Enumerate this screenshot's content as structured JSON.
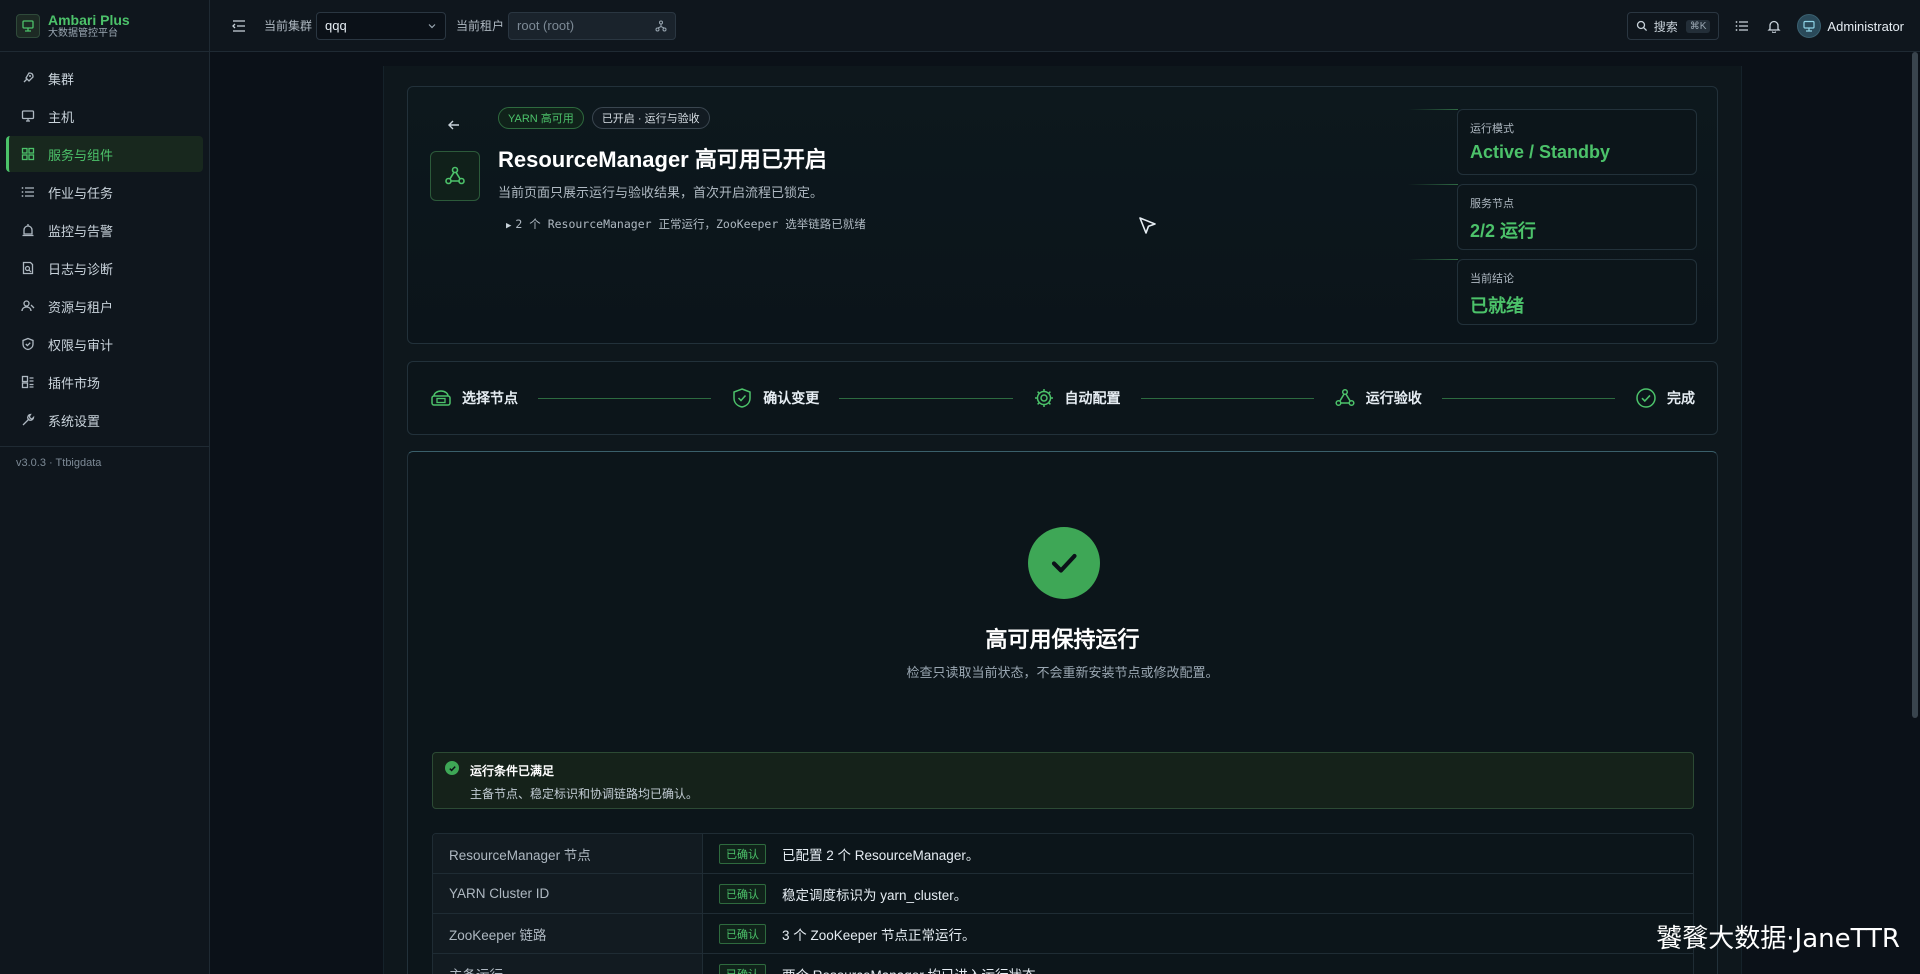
{
  "brand": {
    "title": "Ambari Plus",
    "subtitle": "大数据管控平台"
  },
  "sidebar": {
    "items": [
      {
        "label": "集群",
        "icon": "rocket-icon"
      },
      {
        "label": "主机",
        "icon": "monitor-icon"
      },
      {
        "label": "服务与组件",
        "icon": "grid-icon",
        "active": true
      },
      {
        "label": "作业与任务",
        "icon": "list-icon"
      },
      {
        "label": "监控与告警",
        "icon": "alarm-icon"
      },
      {
        "label": "日志与诊断",
        "icon": "log-search-icon"
      },
      {
        "label": "资源与租户",
        "icon": "users-icon"
      },
      {
        "label": "权限与审计",
        "icon": "shield-icon"
      },
      {
        "label": "插件市场",
        "icon": "plugin-icon"
      },
      {
        "label": "系统设置",
        "icon": "wrench-icon"
      }
    ],
    "version": "v3.0.3 · Ttbigdata"
  },
  "topbar": {
    "cluster_label": "当前集群",
    "cluster_value": "qqq",
    "tenant_label": "当前租户",
    "tenant_value": "root (root)",
    "search_label": "搜索",
    "search_shortcut": "⌘K",
    "user_name": "Administrator"
  },
  "header": {
    "tag_primary": "YARN 高可用",
    "tag_secondary": "已开启 · 运行与验收",
    "title": "ResourceManager 高可用已开启",
    "description": "当前页面只展示运行与验收结果，首次开启流程已锁定。",
    "detail": "2 个 ResourceManager 正常运行，ZooKeeper 选举链路已就绪",
    "stats": [
      {
        "label": "运行模式",
        "value": "Active / Standby"
      },
      {
        "label": "服务节点",
        "value": "2/2 运行"
      },
      {
        "label": "当前结论",
        "value": "已就绪"
      }
    ]
  },
  "steps": [
    {
      "label": "选择节点",
      "icon": "server-stack-icon"
    },
    {
      "label": "确认变更",
      "icon": "shield-check-icon"
    },
    {
      "label": "自动配置",
      "icon": "gear-icon"
    },
    {
      "label": "运行验收",
      "icon": "cluster-nodes-icon"
    },
    {
      "label": "完成",
      "icon": "check-circle-icon"
    }
  ],
  "result": {
    "title": "高可用保持运行",
    "subtitle": "检查只读取当前状态，不会重新安装节点或修改配置。",
    "condition_title": "运行条件已满足",
    "condition_desc": "主备节点、稳定标识和协调链路均已确认。",
    "rows": [
      {
        "name": "ResourceManager 节点",
        "status": "已确认",
        "text": "已配置 2 个 ResourceManager。"
      },
      {
        "name": "YARN Cluster ID",
        "status": "已确认",
        "text": "稳定调度标识为 yarn_cluster。"
      },
      {
        "name": "ZooKeeper 链路",
        "status": "已确认",
        "text": "3 个 ZooKeeper 节点正常运行。"
      },
      {
        "name": "主备运行",
        "status": "已确认",
        "text": "两个 ResourceManager 均已进入运行状态。"
      }
    ]
  },
  "watermark": "饕餮大数据·JaneTTR",
  "colors": {
    "accent": "#4cc26a",
    "background": "#0b1118",
    "panel": "#0c151a"
  }
}
